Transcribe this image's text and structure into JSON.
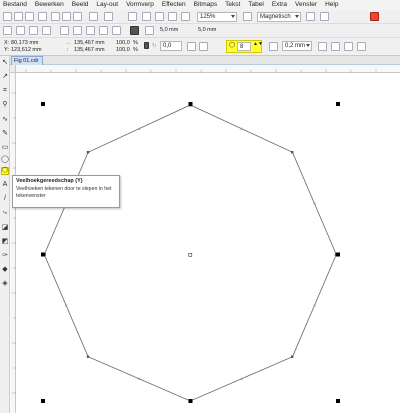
{
  "menu": {
    "items": [
      "Bestand",
      "Bewerken",
      "Beeld",
      "Lay-out",
      "Vormverp",
      "Effecten",
      "Bitmaps",
      "Tekst",
      "Tabel",
      "Extra",
      "Venster",
      "Help"
    ]
  },
  "toolbar": {
    "zoom_value": "125%",
    "snap_value": "Magnetisch",
    "nudge_x": "5,0 mm",
    "nudge_y": "5,0 mm"
  },
  "propbar": {
    "x_label": "X:",
    "x_value": "80,173 mm",
    "y_label": "Y:",
    "y_value": "123,612 mm",
    "width_value": "135,467 mm",
    "height_value": "135,467 mm",
    "scale_x": "100,0",
    "scale_y": "100,0",
    "percent": "%",
    "rotation_value": "0,0",
    "sides_value": "8",
    "outline_value": "0,2 mm"
  },
  "document": {
    "tab_label": "Fig 01.cdr"
  },
  "tooltip": {
    "title": "Veelhoekgereedschap (Y)",
    "body": "Veelhoeken tekenen door te slepen in het tekenvenster"
  },
  "colors": {
    "highlight": "#ffff33",
    "shape_stroke": "#666666"
  },
  "icons": {
    "polygon_tool": "polygon-icon",
    "pick_tool": "arrow-icon"
  }
}
